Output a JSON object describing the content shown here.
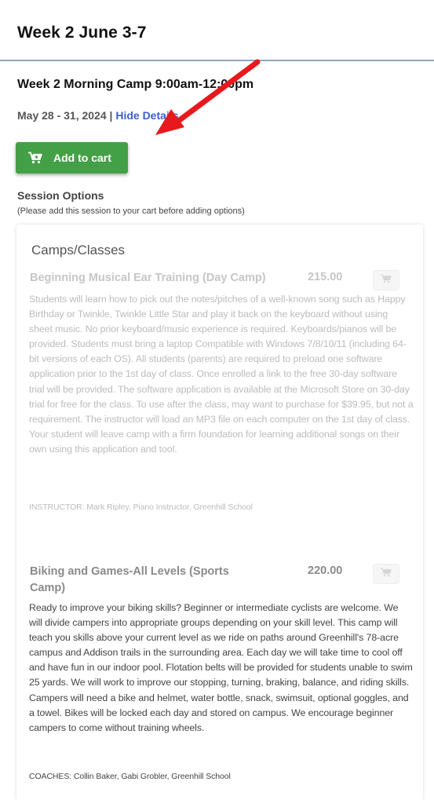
{
  "header": {
    "title": "Week 2 June 3-7"
  },
  "session": {
    "title": "Week 2 Morning Camp 9:00am-12:00pm",
    "dates": "May 28 - 31, 2024",
    "separator": " | ",
    "hide_details": "Hide Details",
    "add_to_cart": "Add to cart"
  },
  "options": {
    "title": "Session Options",
    "note": "(Please add this session to your cart before adding options)",
    "section_title": "Camps/Classes",
    "items": [
      {
        "name": "Beginning Musical Ear Training (Day Camp)",
        "price": "215.00",
        "description": "Students will learn how to pick out the notes/pitches of a well-known song such as Happy Birthday or Twinkle, Twinkle Little Star and play it back on the keyboard without using sheet music. No prior keyboard/music experience is required. Keyboards/pianos will be provided. Students must bring a laptop Compatible with Windows 7/8/10/11 (including 64-bit versions of each OS). All students (parents) are required to preload one software application prior to the 1st day of class. Once enrolled a link to the free 30-day software trial will be provided. The software application is available at the Microsoft Store on 30-day trial for free for the class. To use after the class, may want to purchase for $39.95, but not a requirement. The instructor will load an MP3 file on each computer on the 1st day of class. Your student will leave camp with a firm foundation for learning additional songs on their own using this application and tool.",
        "instructor": "INSTRUCTOR: Mark Ripley, Piano Instructor, Greenhill School"
      },
      {
        "name": "Biking and Games-All Levels (Sports Camp)",
        "price": "220.00",
        "description": "Ready to improve your biking skills? Beginner or intermediate cyclists are welcome. We will divide campers into appropriate groups depending on your skill level. This camp will teach you skills above your current level as we ride on paths around Greenhill's 78-acre campus and Addison trails in the surrounding area. Each day we will take time to cool off and have fun in our indoor pool. Flotation belts will be provided for students unable to swim 25 yards. We will work to improve our stopping, turning, braking, balance, and riding skills. Campers will need a bike and helmet, water bottle, snack, swimsuit, optional goggles, and a towel. Bikes will be locked each day and stored on campus. We encourage beginner campers to come without training wheels.",
        "instructor": "COACHES: Collin Baker, Gabi Grobler, Greenhill School"
      }
    ]
  },
  "colors": {
    "add_button": "#44a047",
    "link": "#3a5fcd",
    "arrow": "#e8191c",
    "header_border": "#8fa3c4"
  },
  "icons": {
    "cart": "cart-plus-icon",
    "annotation": "red-arrow-icon"
  }
}
